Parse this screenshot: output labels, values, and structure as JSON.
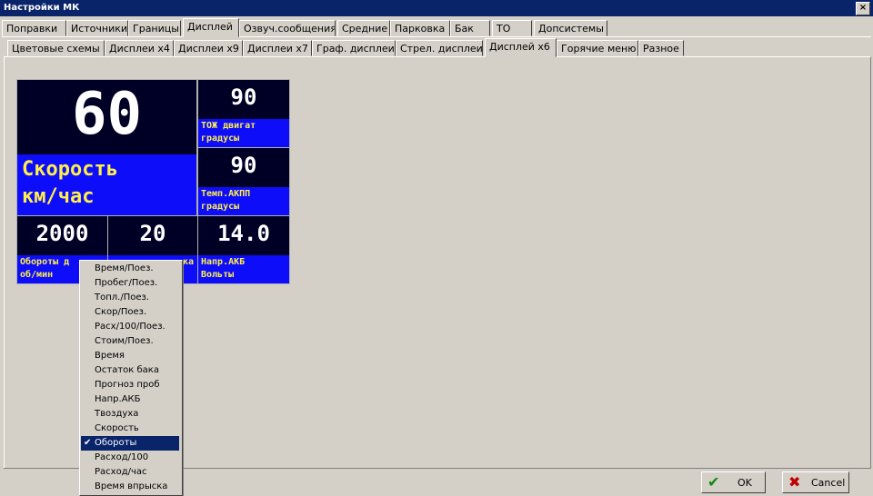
{
  "window": {
    "title": "Настройки МК",
    "close_glyph": "×"
  },
  "main_tabs": [
    {
      "label": "Поправки"
    },
    {
      "label": "Источники"
    },
    {
      "label": "Границы"
    },
    {
      "label": "Дисплей",
      "active": true
    },
    {
      "label": "Озвуч.сообщения"
    },
    {
      "label": "Средние"
    },
    {
      "label": "Парковка"
    },
    {
      "label": "Бак"
    },
    {
      "label": "ТО"
    },
    {
      "label": "Допсистемы"
    }
  ],
  "sub_tabs": [
    {
      "label": "Цветовые схемы"
    },
    {
      "label": "Дисплеи х4"
    },
    {
      "label": "Дисплеи х9"
    },
    {
      "label": "Дисплеи х7"
    },
    {
      "label": "Граф. дисплеи"
    },
    {
      "label": "Стрел. дисплеи"
    },
    {
      "label": "Дисплей х6",
      "active": true
    },
    {
      "label": "Горячие меню"
    },
    {
      "label": "Разное"
    }
  ],
  "display": {
    "speed": {
      "value": "60",
      "label": "Скорость\nкм/час"
    },
    "coolant": {
      "value": "90",
      "label": "ТОЖ двигат\nградусы"
    },
    "transmission": {
      "value": "90",
      "label": "Темп.АКПП\nградусы"
    },
    "rpm": {
      "value": "2000",
      "label": "Обороты д\nоб/мин"
    },
    "middle": {
      "value": "20",
      "label": "ка"
    },
    "battery": {
      "value": "14.0",
      "label": "Напр.АКБ\nВольты"
    }
  },
  "dropdown": {
    "items": [
      {
        "label": "Время/Поез."
      },
      {
        "label": "Пробег/Поез."
      },
      {
        "label": "Топл./Поез."
      },
      {
        "label": "Скор/Поез."
      },
      {
        "label": "Расх/100/Поез."
      },
      {
        "label": "Стоим/Поез."
      },
      {
        "label": "Время"
      },
      {
        "label": "Остаток бака"
      },
      {
        "label": "Прогноз проб"
      },
      {
        "label": "Напр.АКБ"
      },
      {
        "label": "Твоздуха"
      },
      {
        "label": "Скорость"
      },
      {
        "label": "Обороты",
        "selected": true
      },
      {
        "label": "Расход/100"
      },
      {
        "label": "Расход/час"
      },
      {
        "label": "Время впрыска"
      }
    ],
    "check_glyph": "✔"
  },
  "buttons": {
    "ok": {
      "label": "OK",
      "icon": "checkmark-icon",
      "glyph": "✔",
      "color": "#0a8a0a"
    },
    "cancel": {
      "label": "Cancel",
      "icon": "cross-icon",
      "glyph": "✖",
      "color": "#c00000"
    }
  },
  "colors": {
    "display_bg": "#000026",
    "label_bg": "#0d0dfa",
    "label_fg": "#ffef4a",
    "value_fg": "#ffffff",
    "titlebar": "#0a246a"
  }
}
